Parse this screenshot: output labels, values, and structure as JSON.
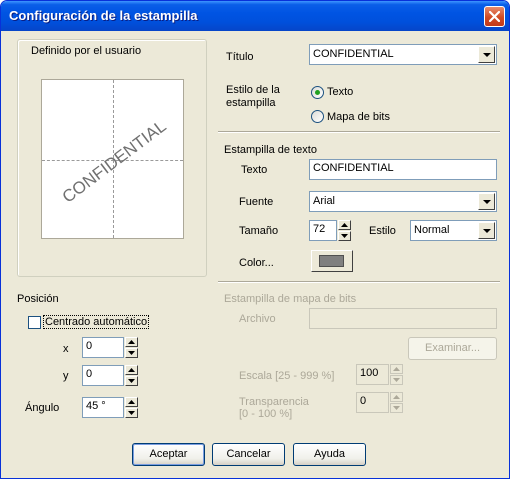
{
  "window": {
    "title": "Configuración de la estampilla"
  },
  "preview": {
    "group_label": "Definido por el usuario",
    "stamp_text": "CONFIDENTIAL"
  },
  "title_row": {
    "label": "Título",
    "value": "CONFIDENTIAL"
  },
  "style_row": {
    "label_line1": "Estilo de la",
    "label_line2": "estampilla",
    "option_text": "Texto",
    "option_bitmap": "Mapa de bits",
    "selected": "Texto"
  },
  "text_stamp": {
    "section_label": "Estampilla de texto",
    "text_label": "Texto",
    "text_value": "CONFIDENTIAL",
    "font_label": "Fuente",
    "font_value": "Arial",
    "size_label": "Tamaño",
    "size_value": "72",
    "style_label": "Estilo",
    "style_value": "Normal",
    "color_label": "Color...",
    "color_value": "#808080"
  },
  "position": {
    "section_label": "Posición",
    "auto_center_label": "Centrado automático",
    "auto_center_checked": false,
    "x_label": "x",
    "x_value": "0",
    "y_label": "y",
    "y_value": "0",
    "angle_label": "Ángulo",
    "angle_value": "45 °"
  },
  "bitmap_stamp": {
    "section_label": "Estampilla de mapa de bits",
    "file_label": "Archivo",
    "file_value": "",
    "browse_label": "Examinar...",
    "scale_label": "Escala [25 - 999 %]",
    "scale_value": "100",
    "transparency_label_line1": "Transparencia",
    "transparency_label_line2": "[0 - 100 %]",
    "transparency_value": "0"
  },
  "footer": {
    "ok_label": "Aceptar",
    "cancel_label": "Cancelar",
    "help_label": "Ayuda"
  }
}
